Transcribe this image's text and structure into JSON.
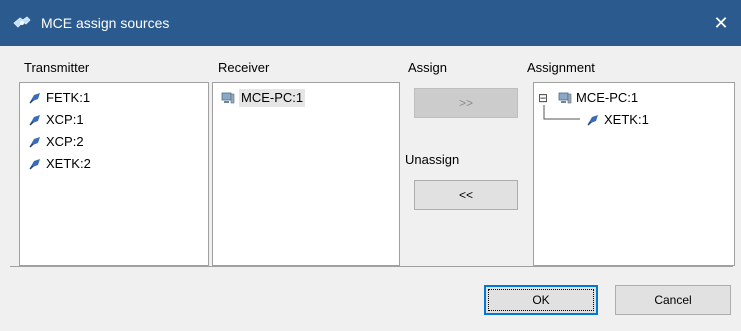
{
  "window": {
    "title": "MCE assign sources",
    "close_glyph": "✕",
    "icon": "network-plug-icon"
  },
  "columns": {
    "transmitter": {
      "label": "Transmitter",
      "items": [
        "FETK:1",
        "XCP:1",
        "XCP:2",
        "XETK:2"
      ]
    },
    "receiver": {
      "label": "Receiver",
      "items": [
        "MCE-PC:1"
      ],
      "selected": "MCE-PC:1"
    },
    "assign": {
      "label": "Assign",
      "assign_button": ">>",
      "unassign_label": "Unassign",
      "unassign_button": "<<"
    },
    "assignment": {
      "label": "Assignment",
      "tree": {
        "expander": "⊟",
        "root": "MCE-PC:1",
        "children": [
          "XETK:1"
        ]
      }
    }
  },
  "footer": {
    "ok_label": "OK",
    "cancel_label": "Cancel"
  },
  "colors": {
    "titlebar": "#2b5a8f",
    "window_bg": "#f0f0f0",
    "list_bg": "#ffffff",
    "accent": "#0078d7"
  }
}
